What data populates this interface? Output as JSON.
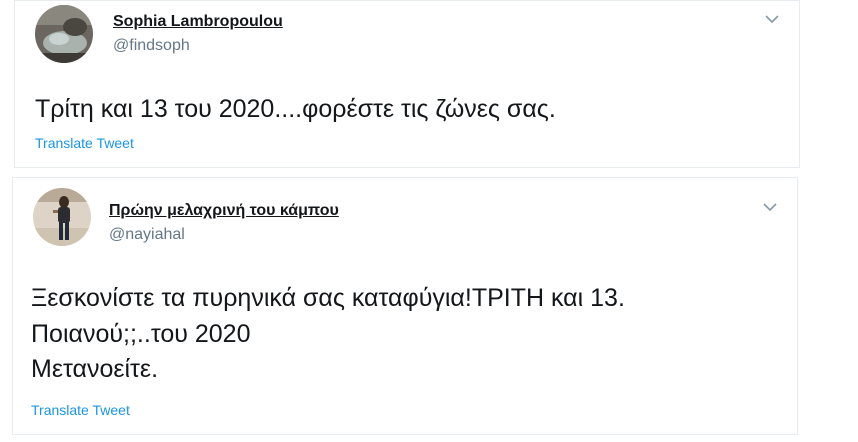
{
  "tweets": [
    {
      "display_name": "Sophia Lambropoulou",
      "handle": "@findsoph",
      "text": "Τρίτη και 13 του 2020....φορέστε τις ζώνες σας.",
      "translate_label": "Translate Tweet",
      "menu_icon": "chevron-down-icon"
    },
    {
      "display_name": "Πρώην μελαχρινή του κάμπου",
      "handle": "@nayiahal",
      "text_lines": [
        "Ξεσκονίστε τα πυρηνικά σας καταφύγια!ΤΡΙΤΗ και 13.",
        "Ποιανού;;..του 2020",
        "Μετανοείτε."
      ],
      "translate_label": "Translate Tweet",
      "menu_icon": "chevron-down-icon"
    }
  ],
  "colors": {
    "text": "#14171a",
    "handle": "#657786",
    "link": "#1b95e0",
    "border": "#e6ecf0"
  }
}
